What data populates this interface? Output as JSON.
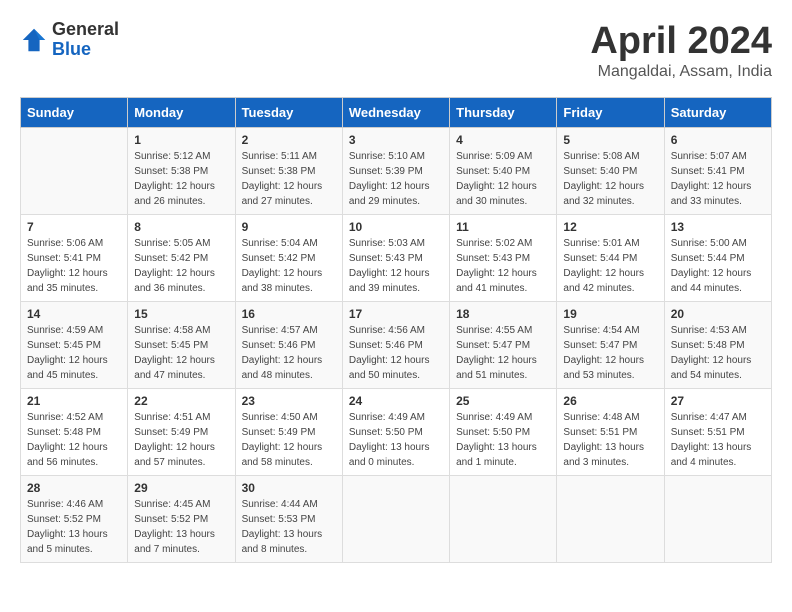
{
  "header": {
    "logo": {
      "general": "General",
      "blue": "Blue"
    },
    "title": "April 2024",
    "location": "Mangaldai, Assam, India"
  },
  "weekdays": [
    "Sunday",
    "Monday",
    "Tuesday",
    "Wednesday",
    "Thursday",
    "Friday",
    "Saturday"
  ],
  "weeks": [
    [
      {
        "day": "",
        "sunrise": "",
        "sunset": "",
        "daylight": ""
      },
      {
        "day": "1",
        "sunrise": "Sunrise: 5:12 AM",
        "sunset": "Sunset: 5:38 PM",
        "daylight": "Daylight: 12 hours and 26 minutes."
      },
      {
        "day": "2",
        "sunrise": "Sunrise: 5:11 AM",
        "sunset": "Sunset: 5:38 PM",
        "daylight": "Daylight: 12 hours and 27 minutes."
      },
      {
        "day": "3",
        "sunrise": "Sunrise: 5:10 AM",
        "sunset": "Sunset: 5:39 PM",
        "daylight": "Daylight: 12 hours and 29 minutes."
      },
      {
        "day": "4",
        "sunrise": "Sunrise: 5:09 AM",
        "sunset": "Sunset: 5:40 PM",
        "daylight": "Daylight: 12 hours and 30 minutes."
      },
      {
        "day": "5",
        "sunrise": "Sunrise: 5:08 AM",
        "sunset": "Sunset: 5:40 PM",
        "daylight": "Daylight: 12 hours and 32 minutes."
      },
      {
        "day": "6",
        "sunrise": "Sunrise: 5:07 AM",
        "sunset": "Sunset: 5:41 PM",
        "daylight": "Daylight: 12 hours and 33 minutes."
      }
    ],
    [
      {
        "day": "7",
        "sunrise": "Sunrise: 5:06 AM",
        "sunset": "Sunset: 5:41 PM",
        "daylight": "Daylight: 12 hours and 35 minutes."
      },
      {
        "day": "8",
        "sunrise": "Sunrise: 5:05 AM",
        "sunset": "Sunset: 5:42 PM",
        "daylight": "Daylight: 12 hours and 36 minutes."
      },
      {
        "day": "9",
        "sunrise": "Sunrise: 5:04 AM",
        "sunset": "Sunset: 5:42 PM",
        "daylight": "Daylight: 12 hours and 38 minutes."
      },
      {
        "day": "10",
        "sunrise": "Sunrise: 5:03 AM",
        "sunset": "Sunset: 5:43 PM",
        "daylight": "Daylight: 12 hours and 39 minutes."
      },
      {
        "day": "11",
        "sunrise": "Sunrise: 5:02 AM",
        "sunset": "Sunset: 5:43 PM",
        "daylight": "Daylight: 12 hours and 41 minutes."
      },
      {
        "day": "12",
        "sunrise": "Sunrise: 5:01 AM",
        "sunset": "Sunset: 5:44 PM",
        "daylight": "Daylight: 12 hours and 42 minutes."
      },
      {
        "day": "13",
        "sunrise": "Sunrise: 5:00 AM",
        "sunset": "Sunset: 5:44 PM",
        "daylight": "Daylight: 12 hours and 44 minutes."
      }
    ],
    [
      {
        "day": "14",
        "sunrise": "Sunrise: 4:59 AM",
        "sunset": "Sunset: 5:45 PM",
        "daylight": "Daylight: 12 hours and 45 minutes."
      },
      {
        "day": "15",
        "sunrise": "Sunrise: 4:58 AM",
        "sunset": "Sunset: 5:45 PM",
        "daylight": "Daylight: 12 hours and 47 minutes."
      },
      {
        "day": "16",
        "sunrise": "Sunrise: 4:57 AM",
        "sunset": "Sunset: 5:46 PM",
        "daylight": "Daylight: 12 hours and 48 minutes."
      },
      {
        "day": "17",
        "sunrise": "Sunrise: 4:56 AM",
        "sunset": "Sunset: 5:46 PM",
        "daylight": "Daylight: 12 hours and 50 minutes."
      },
      {
        "day": "18",
        "sunrise": "Sunrise: 4:55 AM",
        "sunset": "Sunset: 5:47 PM",
        "daylight": "Daylight: 12 hours and 51 minutes."
      },
      {
        "day": "19",
        "sunrise": "Sunrise: 4:54 AM",
        "sunset": "Sunset: 5:47 PM",
        "daylight": "Daylight: 12 hours and 53 minutes."
      },
      {
        "day": "20",
        "sunrise": "Sunrise: 4:53 AM",
        "sunset": "Sunset: 5:48 PM",
        "daylight": "Daylight: 12 hours and 54 minutes."
      }
    ],
    [
      {
        "day": "21",
        "sunrise": "Sunrise: 4:52 AM",
        "sunset": "Sunset: 5:48 PM",
        "daylight": "Daylight: 12 hours and 56 minutes."
      },
      {
        "day": "22",
        "sunrise": "Sunrise: 4:51 AM",
        "sunset": "Sunset: 5:49 PM",
        "daylight": "Daylight: 12 hours and 57 minutes."
      },
      {
        "day": "23",
        "sunrise": "Sunrise: 4:50 AM",
        "sunset": "Sunset: 5:49 PM",
        "daylight": "Daylight: 12 hours and 58 minutes."
      },
      {
        "day": "24",
        "sunrise": "Sunrise: 4:49 AM",
        "sunset": "Sunset: 5:50 PM",
        "daylight": "Daylight: 13 hours and 0 minutes."
      },
      {
        "day": "25",
        "sunrise": "Sunrise: 4:49 AM",
        "sunset": "Sunset: 5:50 PM",
        "daylight": "Daylight: 13 hours and 1 minute."
      },
      {
        "day": "26",
        "sunrise": "Sunrise: 4:48 AM",
        "sunset": "Sunset: 5:51 PM",
        "daylight": "Daylight: 13 hours and 3 minutes."
      },
      {
        "day": "27",
        "sunrise": "Sunrise: 4:47 AM",
        "sunset": "Sunset: 5:51 PM",
        "daylight": "Daylight: 13 hours and 4 minutes."
      }
    ],
    [
      {
        "day": "28",
        "sunrise": "Sunrise: 4:46 AM",
        "sunset": "Sunset: 5:52 PM",
        "daylight": "Daylight: 13 hours and 5 minutes."
      },
      {
        "day": "29",
        "sunrise": "Sunrise: 4:45 AM",
        "sunset": "Sunset: 5:52 PM",
        "daylight": "Daylight: 13 hours and 7 minutes."
      },
      {
        "day": "30",
        "sunrise": "Sunrise: 4:44 AM",
        "sunset": "Sunset: 5:53 PM",
        "daylight": "Daylight: 13 hours and 8 minutes."
      },
      {
        "day": "",
        "sunrise": "",
        "sunset": "",
        "daylight": ""
      },
      {
        "day": "",
        "sunrise": "",
        "sunset": "",
        "daylight": ""
      },
      {
        "day": "",
        "sunrise": "",
        "sunset": "",
        "daylight": ""
      },
      {
        "day": "",
        "sunrise": "",
        "sunset": "",
        "daylight": ""
      }
    ]
  ]
}
